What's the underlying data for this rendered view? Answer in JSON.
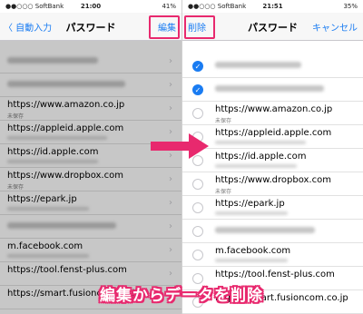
{
  "left": {
    "status": {
      "carrier": "●●○○○ SoftBank",
      "time": "21:00",
      "battery": "41%"
    },
    "nav": {
      "back": "〈 自動入力",
      "title": "パスワード",
      "edit": "編集"
    },
    "rows": [
      {
        "main": "https://www.amazon.co.jp",
        "sub": "未保存"
      },
      {
        "main": "https://appleid.apple.com",
        "sub": ""
      },
      {
        "main": "https://id.apple.com",
        "sub": ""
      },
      {
        "main": "https://www.dropbox.com",
        "sub": "未保存"
      },
      {
        "main": "https://epark.jp",
        "sub": ""
      },
      {
        "main": "m.facebook.com",
        "sub": ""
      },
      {
        "main": "https://tool.fenst-plus.com",
        "sub": ""
      },
      {
        "main": "https://smart.fusioncom.co.jp",
        "sub": ""
      }
    ]
  },
  "right": {
    "status": {
      "carrier": "●●○○○ SoftBank",
      "time": "21:51",
      "battery": "35%"
    },
    "nav": {
      "delete": "削除",
      "title": "パスワード",
      "cancel": "キャンセル"
    },
    "rows": [
      {
        "main": "https://www.amazon.co.jp",
        "sub": "未保存"
      },
      {
        "main": "https://appleid.apple.com",
        "sub": ""
      },
      {
        "main": "https://id.apple.com",
        "sub": ""
      },
      {
        "main": "https://www.dropbox.com",
        "sub": "未保存"
      },
      {
        "main": "https://epark.jp",
        "sub": ""
      },
      {
        "main": "m.facebook.com",
        "sub": ""
      },
      {
        "main": "https://tool.fenst-plus.com",
        "sub": ""
      },
      {
        "main": "https://smart.fusioncom.co.jp",
        "sub": ""
      }
    ]
  },
  "caption": "編集からデータを削除",
  "colors": {
    "accent": "#e8296e",
    "ios_blue": "#1a7cf2"
  }
}
